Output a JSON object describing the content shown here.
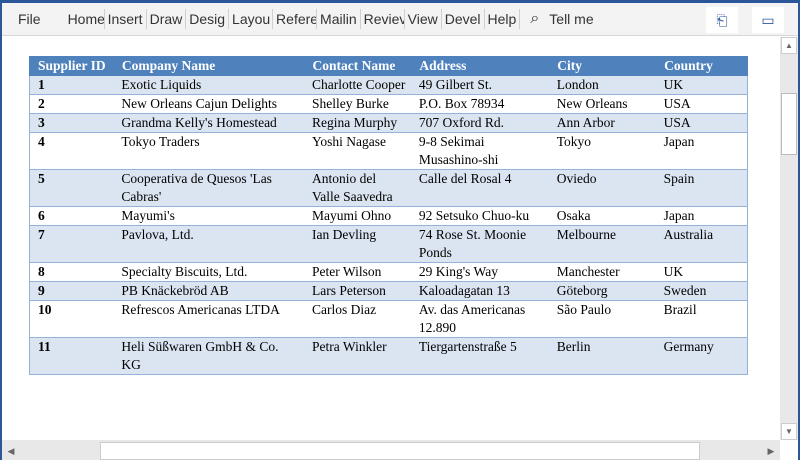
{
  "ribbon": {
    "tabs": [
      "File",
      "Home",
      "Insert",
      "Draw",
      "Desig",
      "Layou",
      "Refere",
      "Mailin",
      "Reviev",
      "View",
      "Devel",
      "Help"
    ],
    "tell_me": "Tell me"
  },
  "table": {
    "headers": [
      "Supplier ID",
      "Company Name",
      "Contact Name",
      "Address",
      "City",
      "Country"
    ],
    "rows": [
      [
        "1",
        "Exotic Liquids",
        "Charlotte Cooper",
        "49 Gilbert St.",
        "London",
        "UK"
      ],
      [
        "2",
        "New Orleans Cajun Delights",
        "Shelley Burke",
        "P.O. Box 78934",
        "New Orleans",
        "USA"
      ],
      [
        "3",
        "Grandma Kelly's Homestead",
        "Regina Murphy",
        "707 Oxford Rd.",
        "Ann Arbor",
        "USA"
      ],
      [
        "4",
        "Tokyo Traders",
        "Yoshi Nagase",
        "9-8 Sekimai Musashino-shi",
        "Tokyo",
        "Japan"
      ],
      [
        "5",
        "Cooperativa de Quesos 'Las Cabras'",
        "Antonio del Valle Saavedra",
        "Calle del Rosal 4",
        "Oviedo",
        "Spain"
      ],
      [
        "6",
        "Mayumi's",
        "Mayumi Ohno",
        "92 Setsuko Chuo-ku",
        "Osaka",
        "Japan"
      ],
      [
        "7",
        "Pavlova, Ltd.",
        "Ian Devling",
        "74 Rose St. Moonie Ponds",
        "Melbourne",
        "Australia"
      ],
      [
        "8",
        "Specialty Biscuits, Ltd.",
        "Peter Wilson",
        "29 King's Way",
        "Manchester",
        "UK"
      ],
      [
        "9",
        "PB Knäckebröd AB",
        "Lars Peterson",
        "Kaloadagatan 13",
        "Göteborg",
        "Sweden"
      ],
      [
        "10",
        "Refrescos Americanas LTDA",
        "Carlos Diaz",
        "Av. das Americanas 12.890",
        "São Paulo",
        "Brazil"
      ],
      [
        "11",
        "Heli Süßwaren GmbH & Co. KG",
        "Petra Winkler",
        "Tiergartenstraße 5",
        "Berlin",
        "Germany"
      ]
    ]
  }
}
